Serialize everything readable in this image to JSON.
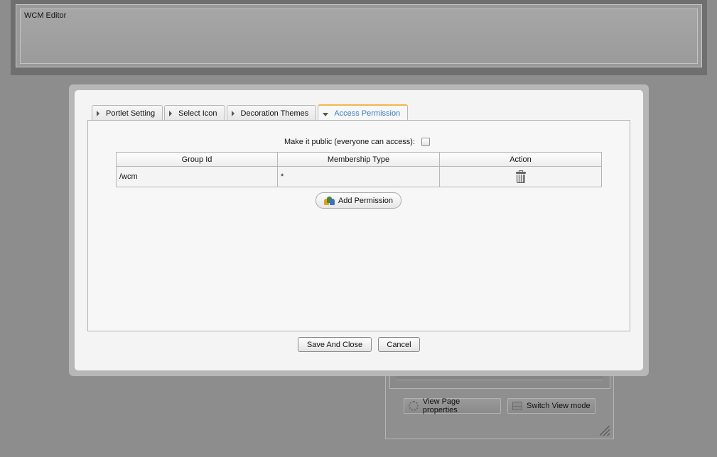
{
  "background": {
    "portlet_title": "WCM Editor",
    "panel": {
      "view_properties_label": "View Page properties",
      "switch_mode_label": "Switch View mode"
    }
  },
  "dialog": {
    "tabs": [
      {
        "label": "Portlet Setting",
        "active": false
      },
      {
        "label": "Select Icon",
        "active": false
      },
      {
        "label": "Decoration Themes",
        "active": false
      },
      {
        "label": "Access Permission",
        "active": true
      }
    ],
    "public_label": "Make it public (everyone can access):",
    "public_checked": false,
    "table": {
      "headers": [
        "Group Id",
        "Membership Type",
        "Action"
      ],
      "rows": [
        {
          "group_id": "/wcm",
          "membership_type": "*"
        }
      ]
    },
    "add_permission_label": "Add Permission",
    "save_label": "Save And Close",
    "cancel_label": "Cancel"
  },
  "colors": {
    "active_tab_text": "#3b7dc4",
    "active_tab_accent": "#f2b846",
    "overlay": "#8d8d8d"
  },
  "icons": {
    "delete": "trash-icon",
    "add_permission": "people-icon"
  }
}
